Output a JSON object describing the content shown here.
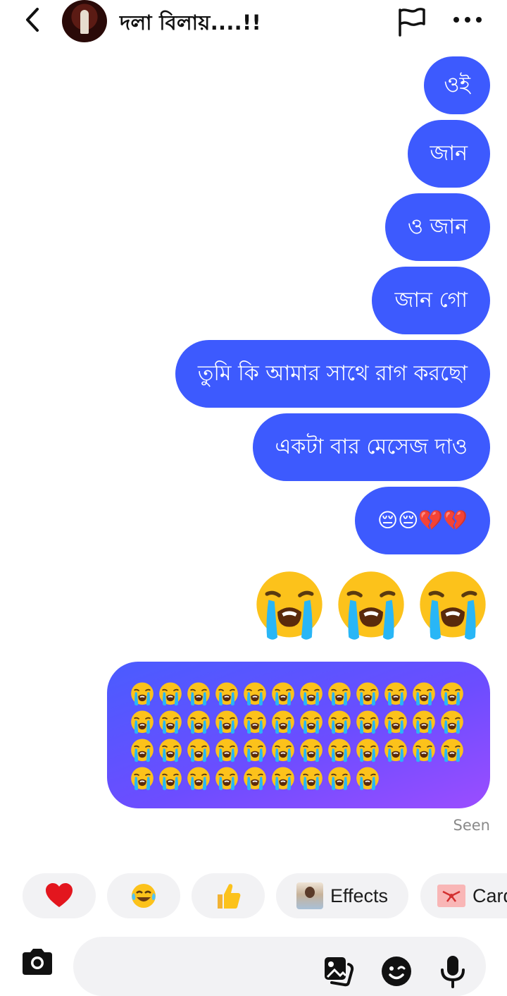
{
  "header": {
    "title": "দলা বিলায়....!!"
  },
  "messages": [
    {
      "text": "ওই"
    },
    {
      "text": "জান"
    },
    {
      "text": "ও জান"
    },
    {
      "text": "জান গো"
    },
    {
      "text": "তুমি কি আমার সাথে রাগ করছো"
    },
    {
      "text": "একটা বার মেসেজ দাও"
    },
    {
      "text": "😔😔💔💔"
    }
  ],
  "big_emoji_count": 3,
  "crying_emoji_message": {
    "emoji_count": 45,
    "icon": "loudly-crying-face-icon"
  },
  "status": {
    "seen": "Seen"
  },
  "quick_actions": {
    "effects_label": "Effects",
    "cards_label": "Cards"
  },
  "composer": {
    "placeholder": ""
  },
  "colors": {
    "accent": "#3d5afe",
    "gradient_start": "#4a5cff",
    "gradient_end": "#9b4dff"
  }
}
